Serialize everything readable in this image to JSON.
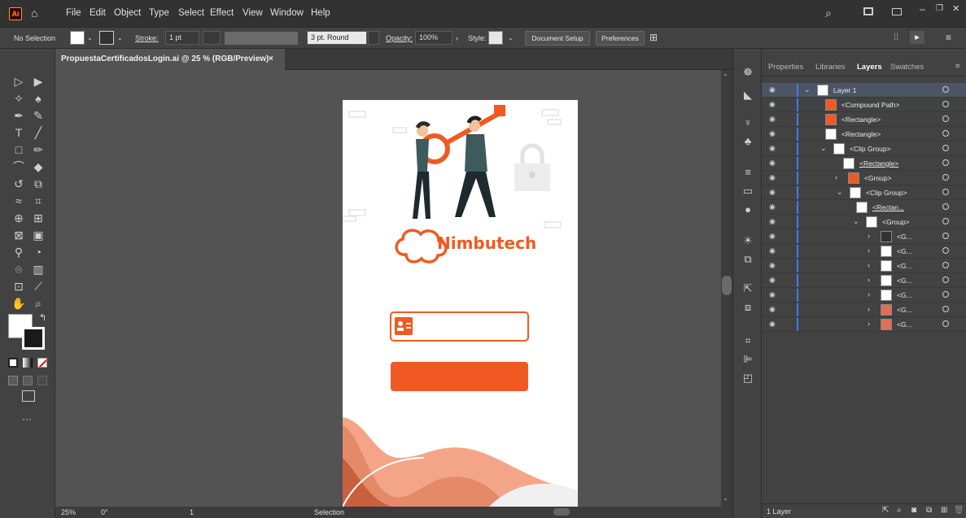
{
  "app": {
    "logo_text": "Ai"
  },
  "menu": [
    "File",
    "Edit",
    "Object",
    "Type",
    "Select",
    "Effect",
    "View",
    "Window",
    "Help"
  ],
  "control_bar": {
    "selection": "No Selection",
    "stroke_label": "Stroke:",
    "stroke_value": "1 pt",
    "brush": "3 pt. Round",
    "opacity_label": "Opacity:",
    "opacity_value": "100%",
    "style_label": "Style:",
    "document_setup": "Document Setup",
    "preferences": "Preferences"
  },
  "document": {
    "tab_title": "PropuestaCertificadosLogin.ai @ 25 % (RGB/Preview)",
    "close": "×"
  },
  "artboard": {
    "brand": "Nimbutech",
    "accent": "#f05a22",
    "accent_soft": "#f4a588"
  },
  "status": {
    "zoom": "25%",
    "rotation": "0°",
    "artboard_num": "1",
    "mode": "Selection"
  },
  "panel": {
    "tabs": [
      "Properties",
      "Libraries",
      "Layers",
      "Swatches"
    ],
    "active_tab": "Layers",
    "layers": [
      {
        "label": "Layer 1"
      },
      {
        "label": "<Compound Path>"
      },
      {
        "label": "<Rectangle>"
      },
      {
        "label": "<Rectangle>"
      },
      {
        "label": "<Clip Group>"
      },
      {
        "label": "<Rectangle>"
      },
      {
        "label": "<Group>"
      },
      {
        "label": "<Clip Group>"
      },
      {
        "label": "<Rectan..."
      },
      {
        "label": "<Group>"
      },
      {
        "label": "<G..."
      },
      {
        "label": "<G..."
      },
      {
        "label": "<G..."
      },
      {
        "label": "<G..."
      },
      {
        "label": "<G..."
      },
      {
        "label": "<G..."
      },
      {
        "label": "<G..."
      }
    ],
    "footer": "1 Layer"
  }
}
